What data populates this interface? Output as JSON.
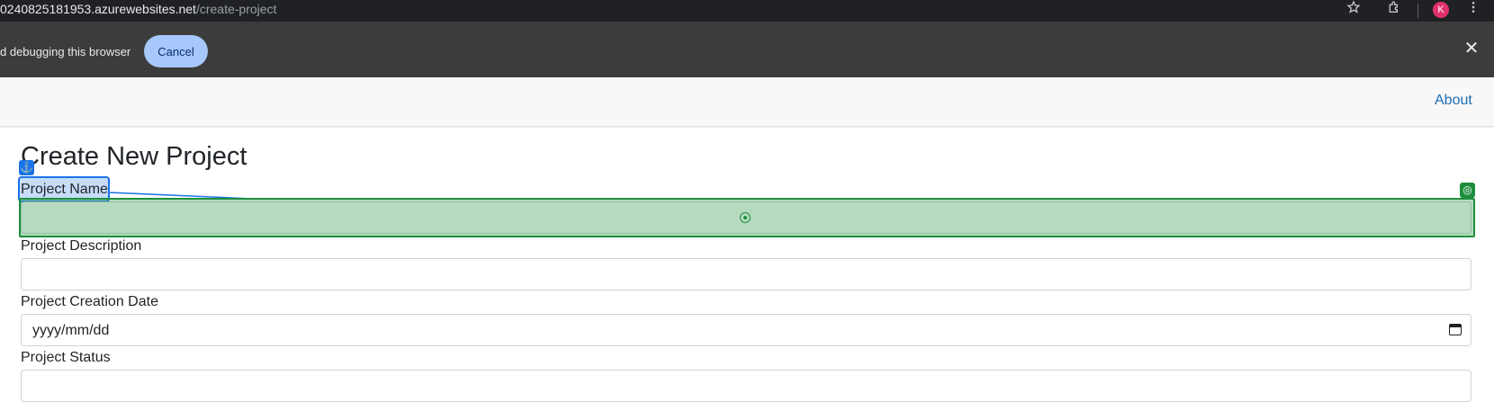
{
  "browser": {
    "url_host": "0240825181953.azurewebsites.net",
    "url_path": "/create-project",
    "avatar_initial": "K",
    "icons": [
      "star-icon",
      "extensions-icon",
      "more-vert-icon"
    ]
  },
  "infobar": {
    "message": "d debugging this browser",
    "cancel_label": "Cancel",
    "close_glyph": "✕"
  },
  "nav": {
    "about_label": "About"
  },
  "form": {
    "title": "Create New Project",
    "name_label": "Project Name",
    "name_value": "",
    "description_label": "Project Description",
    "description_value": "",
    "date_label": "Project Creation Date",
    "date_placeholder": "yyyy/mm/dd",
    "status_label": "Project Status",
    "status_value": ""
  },
  "overlay": {
    "anchor_glyph": "⚓",
    "target_glyph": "◎",
    "colors": {
      "anchor": "#1a73e8",
      "target": "#1e8e3e"
    }
  },
  "colors": {
    "accent": "#1a6eb5",
    "cancel_button": "#a8c7fa",
    "avatar": "#e2316a"
  }
}
